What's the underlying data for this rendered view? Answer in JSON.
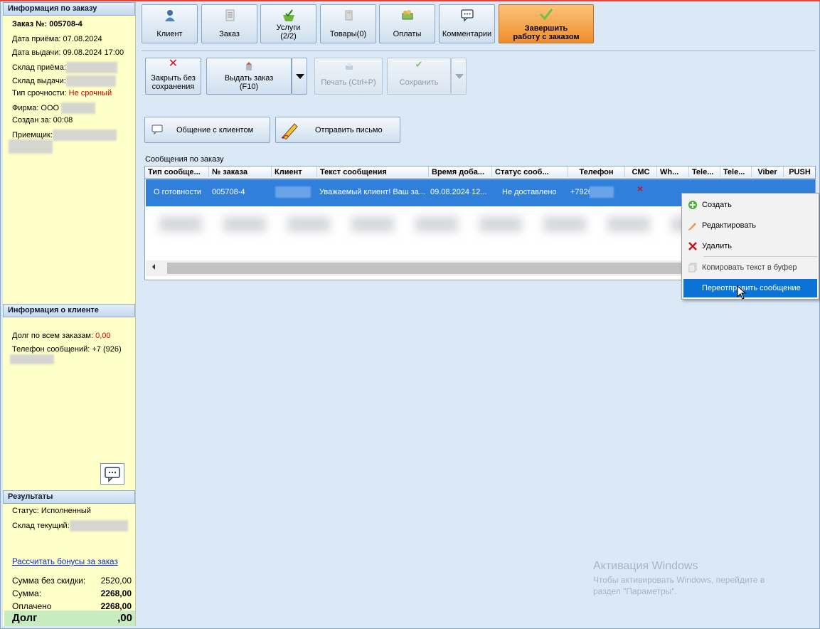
{
  "order_info": {
    "header": "Информация по заказу",
    "order_no": "Заказ №: 005708-4",
    "date_received": "Дата приёма: 07.08.2024",
    "date_issued": "Дата выдачи: 09.08.2024 17:00",
    "warehouse_in_label": "Склад приёма:",
    "warehouse_out_label": "Склад выдачи:",
    "urgency_label": "Тип срочности:",
    "urgency_value": "Не срочный",
    "firm_label": "Фирма: ООО",
    "created_in": "Создан за: 00:08",
    "receiver_label": "Приемщик:"
  },
  "client_info": {
    "header": "Информация о клиенте",
    "debt_label": "Долг по всем заказам:",
    "debt_value": "0,00",
    "phone_label": "Телефон сообщений: +7 (926)"
  },
  "results": {
    "header": "Результаты",
    "status": "Статус: Исполненный",
    "warehouse_label": "Склад текущий:",
    "bonus_link": "Рассчитать бонусы за заказ",
    "sum_nodiscount_label": "Сумма без скидки:",
    "sum_nodiscount_value": "2520,00",
    "sum_label": "Сумма:",
    "sum_value": "2268,00",
    "paid_label": "Оплачено",
    "paid_value": "2268,00",
    "debt_label": "Долг",
    "debt_value": ",00"
  },
  "toolbar": {
    "client": "Клиент",
    "order": "Заказ",
    "services": "Услуги\n(2/2)",
    "goods": "Товары(0)",
    "payments": "Оплаты",
    "comments": "Комментарии",
    "finish": "Завершить\nработу с заказом"
  },
  "actions": {
    "close_nosave": "Закрыть без\nсохранения",
    "issue_order": "Выдать заказ\n(F10)",
    "print": "Печать (Ctrl+P)",
    "save": "Сохранить",
    "chat_client": "Общение с клиентом",
    "send_letter": "Отправить письмо"
  },
  "grid": {
    "caption": "Сообщения по заказу",
    "headers": [
      "Тип сообще...",
      "№ заказа",
      "Клиент",
      "Текст сообщения",
      "Время доба...",
      "Статус сооб...",
      "Телефон",
      "СМС",
      "Wh...",
      "Tele...",
      "Tele...",
      "Viber",
      "PUSH"
    ],
    "row": {
      "type": "О готовности",
      "order_no": "005708-4",
      "text": "Уважаемый клиент! Ваш за...",
      "time": "09.08.2024 12...",
      "status": "Не доставлено",
      "phone": "+7926",
      "sms": "×"
    }
  },
  "context_menu": {
    "create": "Создать",
    "edit": "Редактировать",
    "delete": "Удалить",
    "copy": "Копировать текст в буфер",
    "resend": "Переотправить сообщение"
  },
  "watermark": {
    "line1": "Активация Windows",
    "line2": "Чтобы активировать Windows, перейдите в",
    "line3": "раздел \"Параметры\"."
  }
}
